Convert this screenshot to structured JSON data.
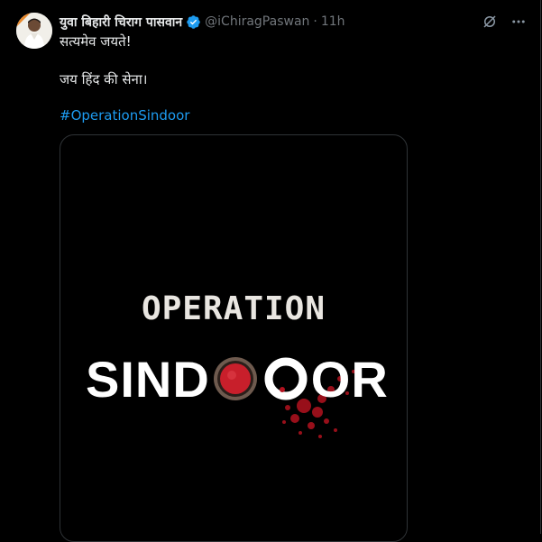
{
  "tweet": {
    "display_name": "युवा बिहारी चिराग पासवान",
    "handle": "@iChiragPaswan",
    "separator": "·",
    "time": "11h",
    "text_line1": "सत्यमेव जयते!",
    "text_line2": "जय हिंद की सेना।",
    "hashtag": "#OperationSindoor"
  },
  "media": {
    "title_line1": "OPERATION",
    "title_left": "SIND",
    "title_right": "OR"
  },
  "icons": {
    "verified": "verified-badge-icon",
    "grok": "grok-icon",
    "more": "more-icon"
  },
  "colors": {
    "background": "#000000",
    "link": "#1d9bf0",
    "muted": "#71767b",
    "verified": "#1d9bf0",
    "accent_red": "#c81f2b"
  }
}
